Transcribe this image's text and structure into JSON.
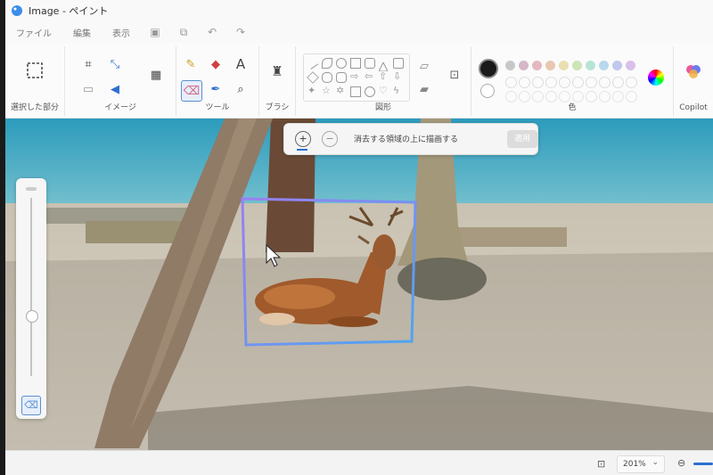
{
  "window": {
    "title": "Image - ペイント"
  },
  "menu": {
    "file": "ファイル",
    "edit": "編集",
    "view": "表示"
  },
  "ribbon": {
    "groups": {
      "selection": "選択した部分",
      "image": "イメージ",
      "tools": "ツール",
      "brushes": "ブラシ",
      "shapes": "図形",
      "colors": "色",
      "copilot": "Copilot"
    },
    "icons": {
      "select": "selection-rect-icon",
      "crop": "crop-icon",
      "resize": "resize-icon",
      "rotate": "rotate-icon",
      "remove_bg": "remove-background-icon",
      "pencil": "pencil-icon",
      "fill": "fill-bucket-icon",
      "text": "text-icon",
      "eraser": "eraser-icon",
      "picker": "color-picker-icon",
      "magnifier": "magnifier-icon",
      "brush": "brush-icon",
      "layers": "layers-icon",
      "copilot": "copilot-icon"
    },
    "colors": {
      "primary": "#1a1a1a",
      "secondary": "#ffffff",
      "palette_row1": [
        "#c8c8c8",
        "#d4b8c8",
        "#e4b8c0",
        "#e8c8b0",
        "#e8e0b0",
        "#cce4b8",
        "#b8e4d4",
        "#b8d8ec",
        "#c0c8ec",
        "#d8c0ec"
      ]
    }
  },
  "prompt": {
    "text": "消去する領域の上に描画する",
    "apply": "適用"
  },
  "status": {
    "zoom": "201%"
  }
}
